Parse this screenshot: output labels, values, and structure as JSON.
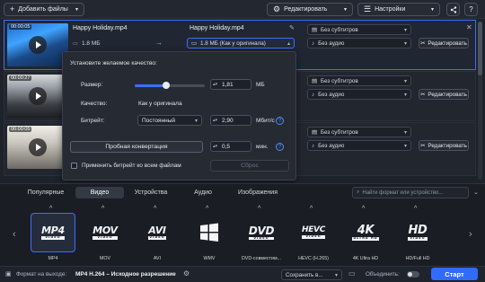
{
  "toolbar": {
    "add_files": "Добавить файлы",
    "edit": "Редактировать",
    "settings": "Настройки"
  },
  "files": [
    {
      "duration": "00:00:05",
      "source_name": "Happy Holiday.mp4",
      "source_size": "1.8 МБ",
      "output_name": "Happy Holiday.mp4",
      "output_size": "1.8 МБ (Как у оригинала)",
      "subtitles": "Без субтитров",
      "audio": "Без аудио",
      "edit_label": "Редактировать"
    },
    {
      "duration": "00:00:27",
      "subtitles": "Без субтитров",
      "audio": "Без аудио",
      "edit_label": "Редактировать"
    },
    {
      "duration": "00:00:05",
      "subtitles": "Без субтитров",
      "audio": "Без аудио",
      "edit_label": "Редактировать"
    }
  ],
  "quality_popup": {
    "heading": "Установите желаемое качество:",
    "size_label": "Размер:",
    "size_value": "1,81",
    "size_unit": "МБ",
    "size_slider_fraction": 0.45,
    "quality_label": "Качество:",
    "quality_value": "Как у оригинала",
    "bitrate_label": "Битрейт:",
    "bitrate_mode": "Постоянный",
    "bitrate_value": "2,90",
    "bitrate_unit": "Мбит/с",
    "trial_button": "Пробная конвертация",
    "trial_minutes": "0,5",
    "trial_unit": "мин.",
    "apply_all": "Применить битрейт ко всем файлам",
    "reset_button": "Сброс"
  },
  "format_tabs": [
    "Популярные",
    "Видео",
    "Устройства",
    "Аудио",
    "Изображения"
  ],
  "active_tab": "Видео",
  "search_placeholder": "Найти формат или устройство...",
  "formats": [
    {
      "logo": "MP4",
      "sub": "VIDEO",
      "name": "MP4"
    },
    {
      "logo": "MOV",
      "sub": "VIDEO",
      "name": "MOV"
    },
    {
      "logo": "AVI",
      "sub": "VIDEO",
      "name": "AVI"
    },
    {
      "logo": "",
      "sub": "",
      "name": "WMV"
    },
    {
      "logo": "DVD",
      "sub": "VIDEO",
      "name": "DVD-совместим..."
    },
    {
      "logo": "HEVC",
      "sub": "VIDEO",
      "name": "HEVC (H.265)"
    },
    {
      "logo": "4K",
      "sub": "ULTRA HD",
      "name": "4K Ultra HD"
    },
    {
      "logo": "HD",
      "sub": "VIDEO",
      "name": "HD/Full HD"
    }
  ],
  "bottom": {
    "output_format_label": "Формат на выходе:",
    "output_format_value": "MP4 H.264 – Исходное разрешение",
    "save_in": "Сохранить в...",
    "merge": "Объединить:",
    "start": "Старт"
  },
  "colors": {
    "accent": "#3d6fff",
    "start": "#2f6bff",
    "background": "#1e222b"
  }
}
